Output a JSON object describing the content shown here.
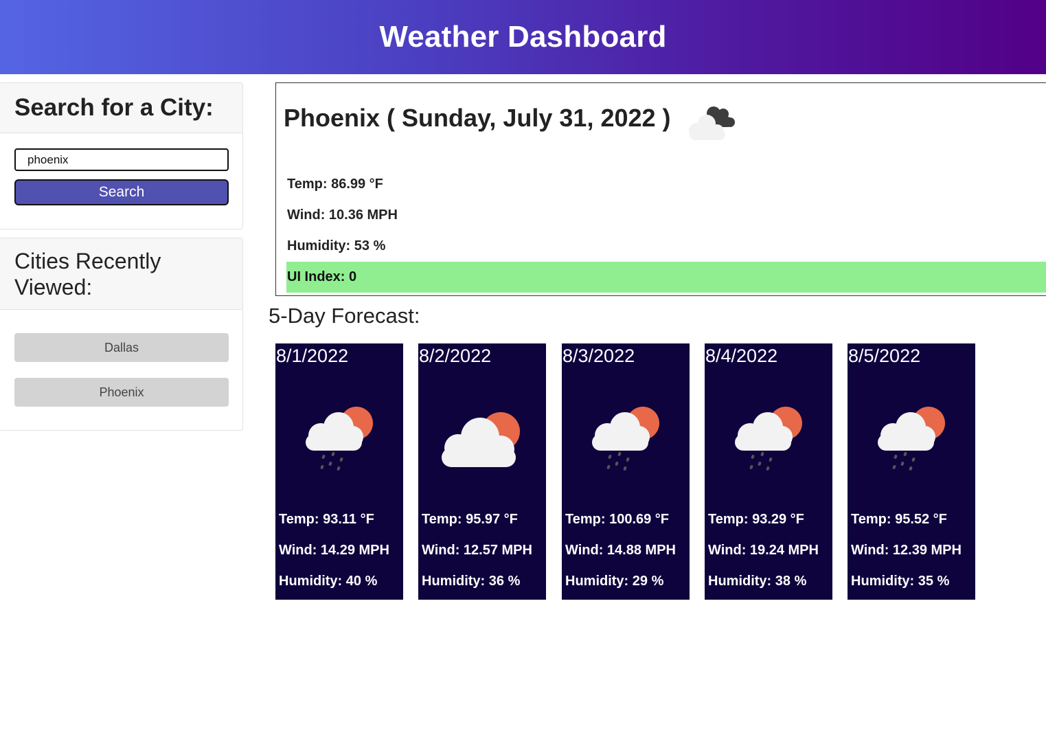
{
  "app": {
    "title": "Weather Dashboard"
  },
  "search": {
    "heading": "Search for a City:",
    "value": "phoenix",
    "button_label": "Search"
  },
  "recent": {
    "heading": "Cities Recently Viewed:",
    "cities": [
      "Dallas",
      "Phoenix"
    ]
  },
  "current": {
    "title": "Phoenix ( Sunday, July 31, 2022 )",
    "icon": "broken-clouds-icon",
    "temp": "Temp: 86.99 °F",
    "wind": "Wind: 10.36 MPH",
    "humidity": "Humidity: 53 %",
    "uv": "UI Index: 0",
    "uv_color": "#90ee90"
  },
  "forecast": {
    "title": "5-Day Forecast:",
    "card_color": "#0e033d",
    "days": [
      {
        "date": "8/1/2022",
        "icon": "sun-rain-cloud-icon",
        "temp": "Temp: 93.11 °F",
        "wind": "Wind: 14.29 MPH",
        "humidity": "Humidity: 40 %"
      },
      {
        "date": "8/2/2022",
        "icon": "partly-cloudy-icon",
        "temp": "Temp: 95.97 °F",
        "wind": "Wind: 12.57 MPH",
        "humidity": "Humidity: 36 %"
      },
      {
        "date": "8/3/2022",
        "icon": "sun-rain-cloud-icon",
        "temp": "Temp: 100.69 °F",
        "wind": "Wind: 14.88 MPH",
        "humidity": "Humidity: 29 %"
      },
      {
        "date": "8/4/2022",
        "icon": "sun-rain-cloud-icon",
        "temp": "Temp: 93.29 °F",
        "wind": "Wind: 19.24 MPH",
        "humidity": "Humidity: 38 %"
      },
      {
        "date": "8/5/2022",
        "icon": "sun-rain-cloud-icon",
        "temp": "Temp: 95.52 °F",
        "wind": "Wind: 12.39 MPH",
        "humidity": "Humidity: 35 %"
      }
    ]
  },
  "colors": {
    "header_start": "#5465e3",
    "header_end": "#520087",
    "search_button": "#5151b0",
    "history_button": "#d3d3d3"
  }
}
